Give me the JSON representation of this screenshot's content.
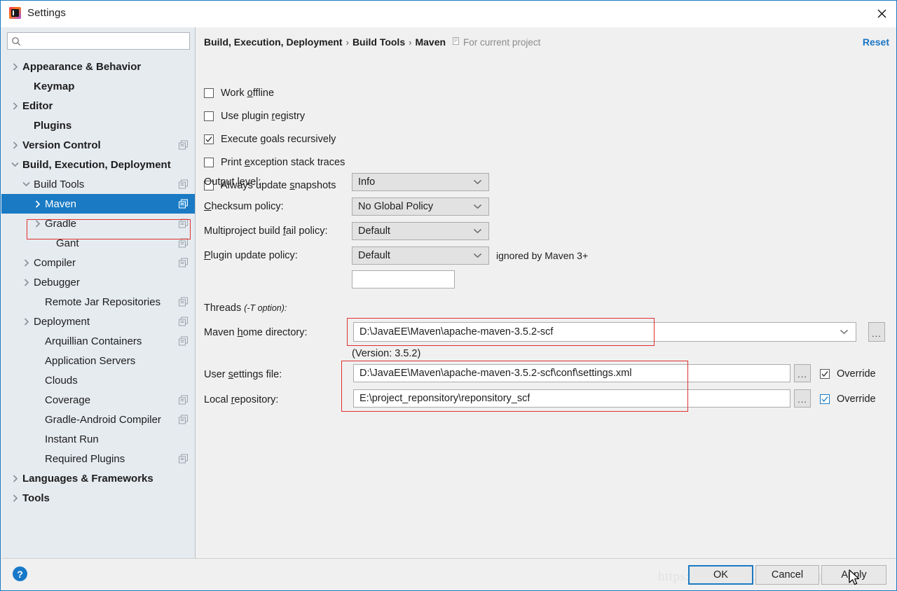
{
  "window": {
    "title": "Settings",
    "logo_icon": "intellij-idea-logo",
    "close_icon": "close-icon"
  },
  "sidebar": {
    "search": {
      "value": "",
      "placeholder": "",
      "icon": "search-icon"
    },
    "items": [
      {
        "label": "Appearance & Behavior",
        "indent": 14,
        "arrow": "chevron-right",
        "bold": true,
        "project_icon": false,
        "selected": false
      },
      {
        "label": "Keymap",
        "indent": 30,
        "arrow": "none",
        "bold": true,
        "project_icon": false,
        "selected": false
      },
      {
        "label": "Editor",
        "indent": 14,
        "arrow": "chevron-right",
        "bold": true,
        "project_icon": false,
        "selected": false
      },
      {
        "label": "Plugins",
        "indent": 30,
        "arrow": "none",
        "bold": true,
        "project_icon": false,
        "selected": false
      },
      {
        "label": "Version Control",
        "indent": 14,
        "arrow": "chevron-right",
        "bold": true,
        "project_icon": true,
        "selected": false
      },
      {
        "label": "Build, Execution, Deployment",
        "indent": 14,
        "arrow": "chevron-down",
        "bold": true,
        "project_icon": false,
        "selected": false
      },
      {
        "label": "Build Tools",
        "indent": 30,
        "arrow": "chevron-down",
        "bold": false,
        "project_icon": true,
        "selected": false
      },
      {
        "label": "Maven",
        "indent": 46,
        "arrow": "chevron-right",
        "bold": false,
        "project_icon": true,
        "selected": true
      },
      {
        "label": "Gradle",
        "indent": 46,
        "arrow": "chevron-right",
        "bold": false,
        "project_icon": true,
        "selected": false
      },
      {
        "label": "Gant",
        "indent": 62,
        "arrow": "none",
        "bold": false,
        "project_icon": true,
        "selected": false
      },
      {
        "label": "Compiler",
        "indent": 30,
        "arrow": "chevron-right",
        "bold": false,
        "project_icon": true,
        "selected": false
      },
      {
        "label": "Debugger",
        "indent": 30,
        "arrow": "chevron-right",
        "bold": false,
        "project_icon": false,
        "selected": false
      },
      {
        "label": "Remote Jar Repositories",
        "indent": 46,
        "arrow": "none",
        "bold": false,
        "project_icon": true,
        "selected": false
      },
      {
        "label": "Deployment",
        "indent": 30,
        "arrow": "chevron-right",
        "bold": false,
        "project_icon": true,
        "selected": false
      },
      {
        "label": "Arquillian Containers",
        "indent": 46,
        "arrow": "none",
        "bold": false,
        "project_icon": true,
        "selected": false
      },
      {
        "label": "Application Servers",
        "indent": 46,
        "arrow": "none",
        "bold": false,
        "project_icon": false,
        "selected": false
      },
      {
        "label": "Clouds",
        "indent": 46,
        "arrow": "none",
        "bold": false,
        "project_icon": false,
        "selected": false
      },
      {
        "label": "Coverage",
        "indent": 46,
        "arrow": "none",
        "bold": false,
        "project_icon": true,
        "selected": false
      },
      {
        "label": "Gradle-Android Compiler",
        "indent": 46,
        "arrow": "none",
        "bold": false,
        "project_icon": true,
        "selected": false
      },
      {
        "label": "Instant Run",
        "indent": 46,
        "arrow": "none",
        "bold": false,
        "project_icon": false,
        "selected": false
      },
      {
        "label": "Required Plugins",
        "indent": 46,
        "arrow": "none",
        "bold": false,
        "project_icon": true,
        "selected": false
      },
      {
        "label": "Languages & Frameworks",
        "indent": 14,
        "arrow": "chevron-right",
        "bold": true,
        "project_icon": false,
        "selected": false
      },
      {
        "label": "Tools",
        "indent": 14,
        "arrow": "chevron-right",
        "bold": true,
        "project_icon": false,
        "selected": false
      }
    ]
  },
  "header": {
    "crumbs": [
      "Build, Execution, Deployment",
      "Build Tools",
      "Maven"
    ],
    "separator": "›",
    "scope_note": "For current project",
    "scope_icon": "project-scope-icon",
    "reset_label": "Reset"
  },
  "main": {
    "checkboxes": [
      {
        "label_pre": "Work ",
        "mnemonic": "o",
        "label_post": "ffline",
        "checked": false
      },
      {
        "label_pre": "Use plugin ",
        "mnemonic": "r",
        "label_post": "egistry",
        "checked": false
      },
      {
        "label_pre": "Execute ",
        "mnemonic": "g",
        "label_post": "oals recursively",
        "checked": true
      },
      {
        "label_pre": "Print ",
        "mnemonic": "e",
        "label_post": "xception stack traces",
        "checked": false
      },
      {
        "label_pre": "Always update ",
        "mnemonic": "s",
        "label_post": "napshots",
        "checked": false
      }
    ],
    "selects": [
      {
        "label_pre": "Output ",
        "mnemonic": "l",
        "label_post": "evel:",
        "value": "Info",
        "hint": ""
      },
      {
        "label_pre": "",
        "mnemonic": "C",
        "label_post": "hecksum policy:",
        "value": "No Global Policy",
        "hint": ""
      },
      {
        "label_pre": "Multiproject build ",
        "mnemonic": "f",
        "label_post": "ail policy:",
        "value": "Default",
        "hint": ""
      },
      {
        "label_pre": "",
        "mnemonic": "P",
        "label_post": "lugin update policy:",
        "value": "Default",
        "hint": "ignored by Maven 3+"
      }
    ],
    "threads": {
      "label": "Threads ",
      "label_italic": "(-T option):",
      "value": ""
    },
    "maven_home": {
      "label_pre": "Maven ",
      "mnemonic": "h",
      "label_post": "ome directory:",
      "value": "D:\\JavaEE\\Maven\\apache-maven-3.5.2-scf",
      "browse_label": "...",
      "version_note": "(Version: 3.5.2)"
    },
    "user_settings": {
      "label_pre": "User ",
      "mnemonic": "s",
      "label_post": "ettings file:",
      "value": "D:\\JavaEE\\Maven\\apache-maven-3.5.2-scf\\conf\\settings.xml",
      "browse_label": "...",
      "override_label": "Override",
      "override_checked": true,
      "override_focused": false
    },
    "local_repo": {
      "label_pre": "Local ",
      "mnemonic": "r",
      "label_post": "epository:",
      "value": "E:\\project_reponsitory\\reponsitory_scf",
      "browse_label": "...",
      "override_label": "Override",
      "override_checked": true,
      "override_focused": true
    }
  },
  "footer": {
    "help_label": "?",
    "buttons": [
      {
        "label": "OK",
        "default": true
      },
      {
        "label": "Cancel",
        "default": false
      },
      {
        "label": "Apply",
        "default": false
      }
    ],
    "watermark": "https://blog.csdn.net/win_sincethe"
  },
  "colors": {
    "accent": "#1a7ac4",
    "selection": "#1a7ac4",
    "annotation": "#e03030",
    "sidebar_bg": "#e6ebf0",
    "panel_bg": "#f0f0f0"
  }
}
